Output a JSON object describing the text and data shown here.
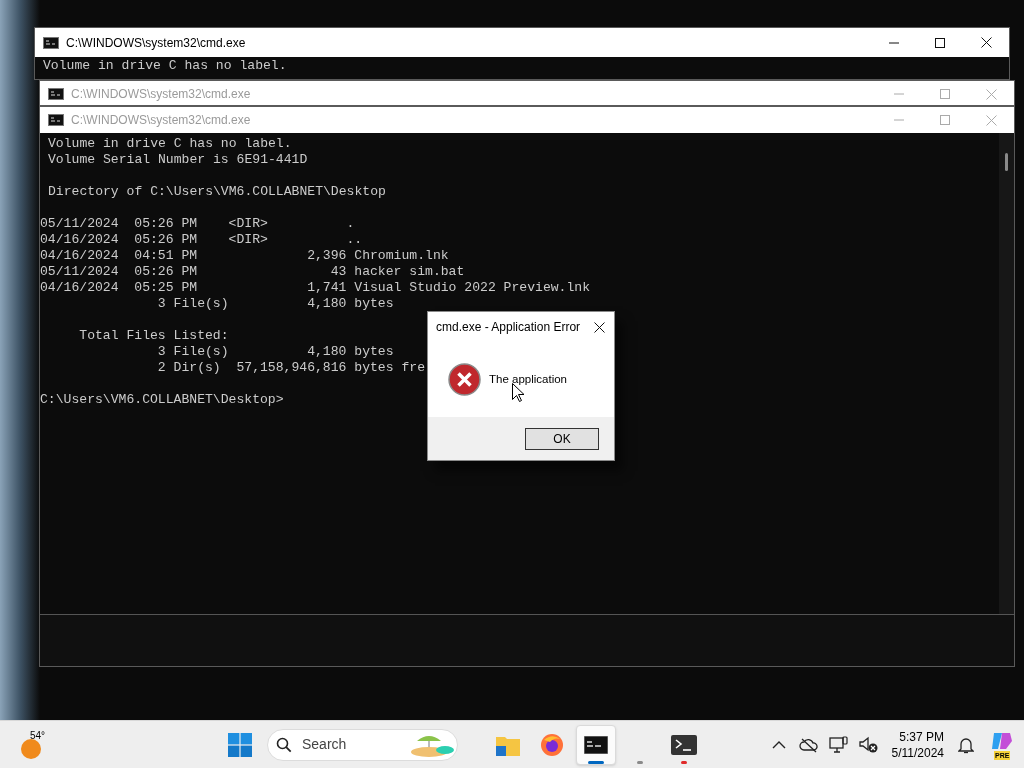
{
  "windows": [
    {
      "title": "C:\\WINDOWS\\system32\\cmd.exe",
      "active": true,
      "blocks": [
        [
          "Volume in drive C has no label."
        ]
      ]
    },
    {
      "title": "C:\\WINDOWS\\system32\\cmd.exe",
      "active": false
    },
    {
      "title": "C:\\WINDOWS\\system32\\cmd.exe",
      "active": false,
      "blocks": [
        [
          "Volume in drive C has no label.",
          "Volume Serial Number is 6E91-441D"
        ],
        [
          "Directory of C:\\Users\\VM6.COLLABNET\\Desktop"
        ],
        [
          "05/11/2024  05:26 PM    <DIR>          .",
          "04/16/2024  05:26 PM    <DIR>          ..",
          "04/16/2024  04:51 PM              2,396 Chromium.lnk",
          "05/11/2024  05:26 PM                 43 hacker sim.bat",
          "04/16/2024  05:25 PM              1,741 Visual Studio 2022 Preview.lnk",
          "               3 File(s)          4,180 bytes"
        ],
        [
          "     Total Files Listed:",
          "               3 File(s)          4,180 bytes",
          "               2 Dir(s)  57,158,946,816 bytes fre"
        ],
        [
          "C:\\Users\\VM6.COLLABNET\\Desktop>"
        ]
      ]
    }
  ],
  "dialog": {
    "title": "cmd.exe - Application Error",
    "message": "The application",
    "buttons": [
      "OK"
    ]
  },
  "taskbar": {
    "weather": {
      "temperature": "54°"
    },
    "search": {
      "label": "Search"
    },
    "apps": [
      {
        "kind": "folder",
        "selected": false,
        "running": false
      },
      {
        "kind": "browser",
        "selected": false,
        "running": false
      },
      {
        "kind": "console",
        "selected": true,
        "running": true,
        "color": "#0067c0"
      },
      {
        "kind": "blank",
        "selected": false,
        "running": true,
        "color": "#8a8a8a"
      },
      {
        "kind": "terminal",
        "selected": false,
        "running": true,
        "color": "#e02a2a"
      }
    ],
    "clock": {
      "time": "5:37 PM",
      "date": "5/11/2024"
    },
    "copilot_badge": "PRE"
  }
}
